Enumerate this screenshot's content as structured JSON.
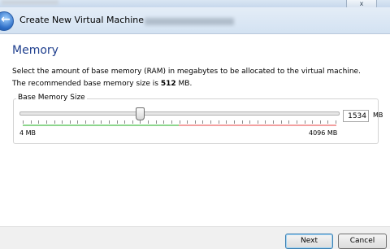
{
  "window": {
    "close_glyph": "x",
    "dialog_title": "Create New Virtual Machine"
  },
  "page": {
    "title": "Memory",
    "description": "Select the amount of base memory (RAM) in megabytes to be allocated to the virtual machine.",
    "recommended_prefix": "The recommended base memory size is",
    "recommended_value": "512",
    "recommended_unit": "MB."
  },
  "memory": {
    "group_label": "Base Memory Size",
    "value": "1534",
    "unit": "MB",
    "min_label": "4 MB",
    "max_label": "4096 MB",
    "slider_fraction": 0.374
  },
  "buttons": {
    "next": "Next",
    "cancel": "Cancel"
  },
  "icons": {
    "back": "back-arrow-icon"
  },
  "colors": {
    "title_blue": "#1f3f8e",
    "safe_zone": "#8ed68e",
    "warn_zone": "#f3a0a0"
  }
}
